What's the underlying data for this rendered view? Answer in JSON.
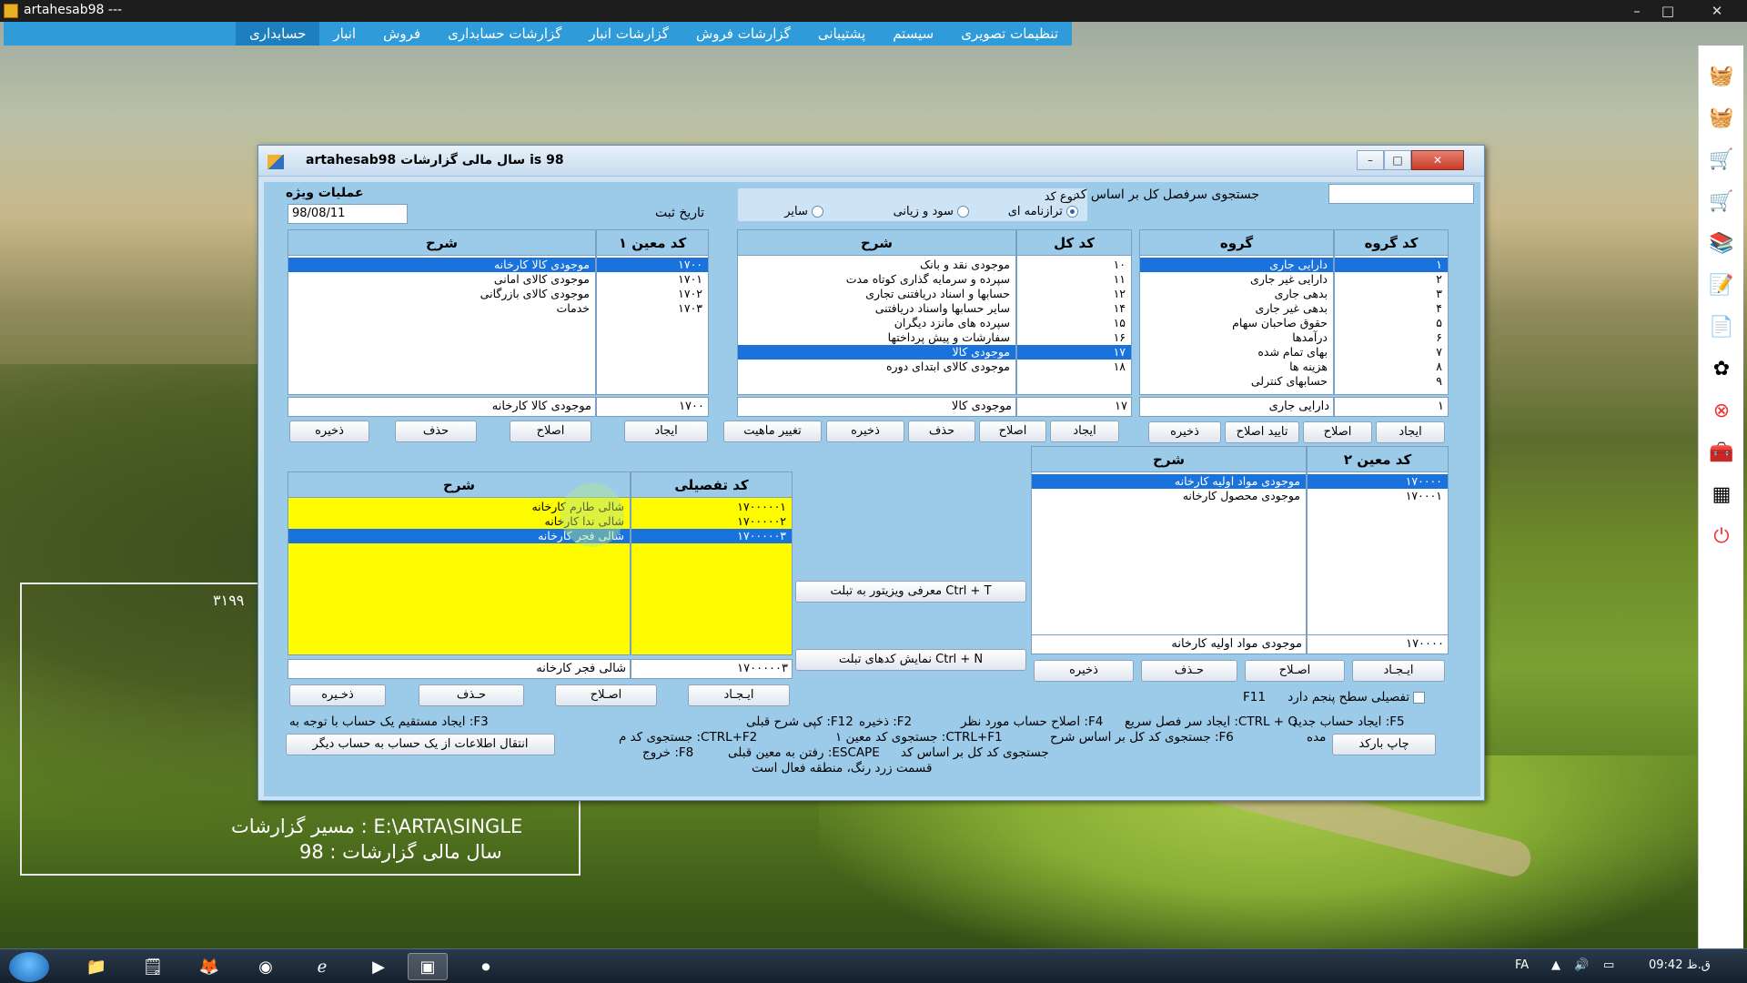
{
  "window": {
    "title": "artahesab98 ---",
    "minimize": "–",
    "maximize": "□",
    "close": "✕"
  },
  "menu": [
    "حسابداری",
    "انبار",
    "فروش",
    "گزارشات حسابداری",
    "گزارشات انبار",
    "گزارشات فروش",
    "پشتیبانی",
    "سیستم",
    "تنظیمات تصویری"
  ],
  "infobox": {
    "number": "۳۱۹۹",
    "path_line": "مسیر گزارشات : E:\\ARTA\\SINGLE",
    "year_line": "سال مالی گزارشات : 98"
  },
  "dialog": {
    "title": "artahesab98   سال مالی گزارشات is 98",
    "special_ops_label": "عملیات ویژه",
    "date_value": "98/08/11",
    "reg_date_label": "تاریخ ثبت",
    "search_label": "جستجوی سرفصل کل بر اساس کد",
    "search_value": "",
    "code_type_label": "نوع کد",
    "radios": [
      {
        "label": "ترازنامه ای",
        "checked": true
      },
      {
        "label": "سود و زیانی",
        "checked": false
      },
      {
        "label": "سایر",
        "checked": false
      }
    ],
    "group_code": {
      "header": "کد گروه",
      "rows": [
        "۱",
        "۲",
        "۳",
        "۴",
        "۵",
        "۶",
        "۷",
        "۸",
        "۹"
      ],
      "selected": 0,
      "current": "۱"
    },
    "group": {
      "header": "گروه",
      "rows": [
        "دارایی جاری",
        "دارایی غیر جاری",
        "بدهی جاری",
        "بدهی غیر جاری",
        "حقوق صاحبان سهام",
        "درآمدها",
        "بهای تمام شده",
        "هزینه ها",
        "حسابهای کنترلی"
      ],
      "selected": 0,
      "current": "دارایی جاری"
    },
    "ledger_code": {
      "header": "کد کل",
      "rows": [
        "۱۰",
        "۱۱",
        "۱۲",
        "۱۴",
        "۱۵",
        "۱۶",
        "۱۷",
        "۱۸"
      ],
      "selected": 6,
      "current": "۱۷"
    },
    "ledger_desc": {
      "header": "شرح",
      "rows": [
        "موجودی نقد و بانک",
        "سپرده و سرمایه گذاری کوتاه مدت",
        "حسابها و اسناد دریافتنی تجاری",
        "سایر حسابها واسناد دریافتنی",
        "سپرده های مانزد دیگران",
        "سفارشات و پیش پرداختها",
        "موجودی کالا",
        "موجودی کالای ابتدای دوره"
      ],
      "selected": 6,
      "current": "موجودی کالا"
    },
    "sub1_code": {
      "header": "کد معین ۱",
      "rows": [
        "۱۷۰۰",
        "۱۷۰۱",
        "۱۷۰۲",
        "۱۷۰۳"
      ],
      "selected": 0,
      "current": "۱۷۰۰"
    },
    "sub1_desc": {
      "header": "شرح",
      "rows": [
        "موجودی کالا کارخانه",
        "موجودی کالای امانی",
        "موجودی کالای بازرگانی",
        "خدمات"
      ],
      "selected": 0,
      "current": "موجودی کالا کارخانه"
    },
    "sub2_code": {
      "header": "کد معین ۲",
      "rows": [
        "۱۷۰۰۰۰",
        "۱۷۰۰۰۱"
      ],
      "selected": 0,
      "current": "۱۷۰۰۰۰"
    },
    "sub2_desc": {
      "header": "شرح",
      "rows": [
        "موجودی مواد اولیه کارخانه",
        "موجودی محصول کارخانه"
      ],
      "selected": 0,
      "current": "موجودی مواد اولیه کارخانه"
    },
    "detail_code": {
      "header": "کد تفصیلی",
      "rows": [
        "۱۷۰۰۰۰۰۱",
        "۱۷۰۰۰۰۰۲",
        "۱۷۰۰۰۰۰۳"
      ],
      "selected": 2,
      "current": "۱۷۰۰۰۰۰۳"
    },
    "detail_desc": {
      "header": "شرح",
      "rows": [
        "شالی طارم کارخانه",
        "شالی ندا کارخانه",
        "شالی فجر کارخانه"
      ],
      "selected": 2,
      "current": "شالی فجر کارخانه"
    },
    "buttons": {
      "create": "ایجاد",
      "edit": "اصلاح",
      "confirm_edit": "تایید اصلاح",
      "save": "ذخیره",
      "delete": "حذف",
      "change_nature": "تغییر ماهیت",
      "create_spaced": "ایـجـاد",
      "edit_spaced": "اصـلاح",
      "delete_spaced": "حـذف",
      "save_spaced": "ذخـیره",
      "introduce_widget": "Ctrl + T  معرفی ویزیتور به تبلت",
      "show_tablet_codes": "Ctrl + N  نمایش کدهای تبلت",
      "transfer": "انتقال اطلاعات از یک حساب به حساب دیگر",
      "print_barcode": "چاپ بارکد"
    },
    "fifth_level": {
      "key": "F11",
      "label": "تفصیلی سطح پنجم دارد"
    },
    "footer": [
      "F5: ایجاد حساب جدید",
      "CTRL + Q: ایجاد سر فصل سریع",
      "F4: اصلاح حساب مورد نظر",
      "F2: ذخیره",
      "F12: کپی شرح قبلی",
      "F3: ایجاد مستقیم یک حساب با توجه به",
      "مده",
      "F6: جستجوی کد کل بر اساس شرح",
      "CTRL+F1: جستجوی کد معین ۱",
      "CTRL+F2: جستجوی کد م",
      "جستجوی کد کل بر اساس کد",
      "ESCAPE: رفتن به معین قبلی",
      "F8: خروج",
      "قسمت زرد رنگ، منطقه فعال است"
    ]
  },
  "taskbar": {
    "lang": "FA",
    "time": "ق.ظ 09:42"
  }
}
